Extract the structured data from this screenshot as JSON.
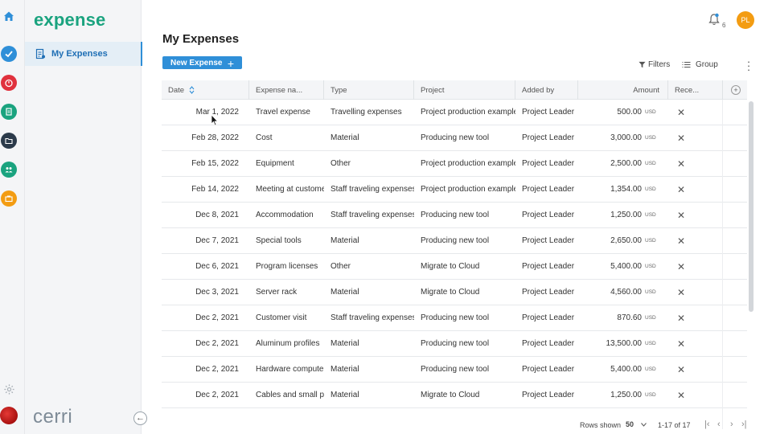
{
  "brand": {
    "logo": "expense",
    "footer_logo": "cerri"
  },
  "rail": {
    "icons": [
      "home-icon",
      "check-icon",
      "timer-icon",
      "expense-report-icon",
      "folder-icon",
      "team-icon",
      "briefcase-icon",
      "settings-icon",
      "user-photo-icon"
    ]
  },
  "sidebar": {
    "items": [
      {
        "label": "My Expenses"
      }
    ],
    "collapse_icon": "←"
  },
  "header": {
    "notification_count": "6",
    "avatar_initials": "PL"
  },
  "page": {
    "title": "My Expenses",
    "new_button_label": "New Expense",
    "new_button_icon": "+",
    "filters_label": "Filters",
    "group_label": "Group"
  },
  "table": {
    "columns": [
      "Date",
      "Expense na...",
      "Type",
      "Project",
      "Added by",
      "Amount",
      "Rece..."
    ],
    "add_column_icon": "+",
    "rows": [
      {
        "date": "Mar 1, 2022",
        "name": "Travel expense",
        "type": "Travelling expenses",
        "project": "Project production example",
        "added_by": "Project Leader",
        "amount": "500.00",
        "currency": "USD"
      },
      {
        "date": "Feb 28, 2022",
        "name": "Cost",
        "type": "Material",
        "project": "Producing new tool",
        "added_by": "Project Leader",
        "amount": "3,000.00",
        "currency": "USD"
      },
      {
        "date": "Feb 15, 2022",
        "name": "Equipment",
        "type": "Other",
        "project": "Project production example",
        "added_by": "Project Leader",
        "amount": "2,500.00",
        "currency": "USD"
      },
      {
        "date": "Feb 14, 2022",
        "name": "Meeting at customer",
        "type": "Staff traveling expenses",
        "project": "Project production example",
        "added_by": "Project Leader",
        "amount": "1,354.00",
        "currency": "USD"
      },
      {
        "date": "Dec 8, 2021",
        "name": "Accommodation",
        "type": "Staff traveling expenses",
        "project": "Producing new tool",
        "added_by": "Project Leader",
        "amount": "1,250.00",
        "currency": "USD"
      },
      {
        "date": "Dec 7, 2021",
        "name": "Special tools",
        "type": "Material",
        "project": "Producing new tool",
        "added_by": "Project Leader",
        "amount": "2,650.00",
        "currency": "USD"
      },
      {
        "date": "Dec 6, 2021",
        "name": "Program licenses",
        "type": "Other",
        "project": "Migrate to Cloud",
        "added_by": "Project Leader",
        "amount": "5,400.00",
        "currency": "USD"
      },
      {
        "date": "Dec 3, 2021",
        "name": "Server rack",
        "type": "Material",
        "project": "Migrate to Cloud",
        "added_by": "Project Leader",
        "amount": "4,560.00",
        "currency": "USD"
      },
      {
        "date": "Dec 2, 2021",
        "name": "Customer visit",
        "type": "Staff traveling expenses",
        "project": "Producing new tool",
        "added_by": "Project Leader",
        "amount": "870.60",
        "currency": "USD"
      },
      {
        "date": "Dec 2, 2021",
        "name": "Aluminum profiles",
        "type": "Material",
        "project": "Producing new tool",
        "added_by": "Project Leader",
        "amount": "13,500.00",
        "currency": "USD"
      },
      {
        "date": "Dec 2, 2021",
        "name": "Hardware computers",
        "type": "Material",
        "project": "Producing new tool",
        "added_by": "Project Leader",
        "amount": "5,400.00",
        "currency": "USD"
      },
      {
        "date": "Dec 2, 2021",
        "name": "Cables and small parts",
        "type": "Material",
        "project": "Migrate to Cloud",
        "added_by": "Project Leader",
        "amount": "1,250.00",
        "currency": "USD"
      }
    ],
    "receipt_icon": "✕"
  },
  "footer": {
    "rows_shown_label": "Rows shown",
    "rows_shown_value": "50",
    "range": "1-17 of 17",
    "first": "|‹",
    "prev": "‹",
    "next": "›",
    "last": "›|"
  },
  "colors": {
    "accent": "#2f8fd8",
    "logo": "#1aa37f",
    "avatar": "#f39c12"
  }
}
